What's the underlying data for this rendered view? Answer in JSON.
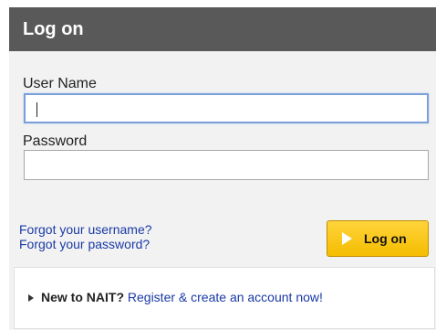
{
  "header": {
    "title": "Log on"
  },
  "form": {
    "username_label": "User Name",
    "username_value": "",
    "password_label": "Password",
    "password_value": ""
  },
  "links": {
    "forgot_username": "Forgot your username?",
    "forgot_password": "Forgot your password?"
  },
  "logon_button": {
    "label": "Log on",
    "icon": "play-triangle-icon",
    "color": "#f5bd00"
  },
  "new_user": {
    "prompt": "New to NAIT?",
    "register_link": "Register & create an account now!",
    "icon": "triangle-bullet-icon"
  },
  "colors": {
    "header_bg": "#595959",
    "link": "#1a3aa6",
    "focus_border": "#7b9fd8"
  }
}
